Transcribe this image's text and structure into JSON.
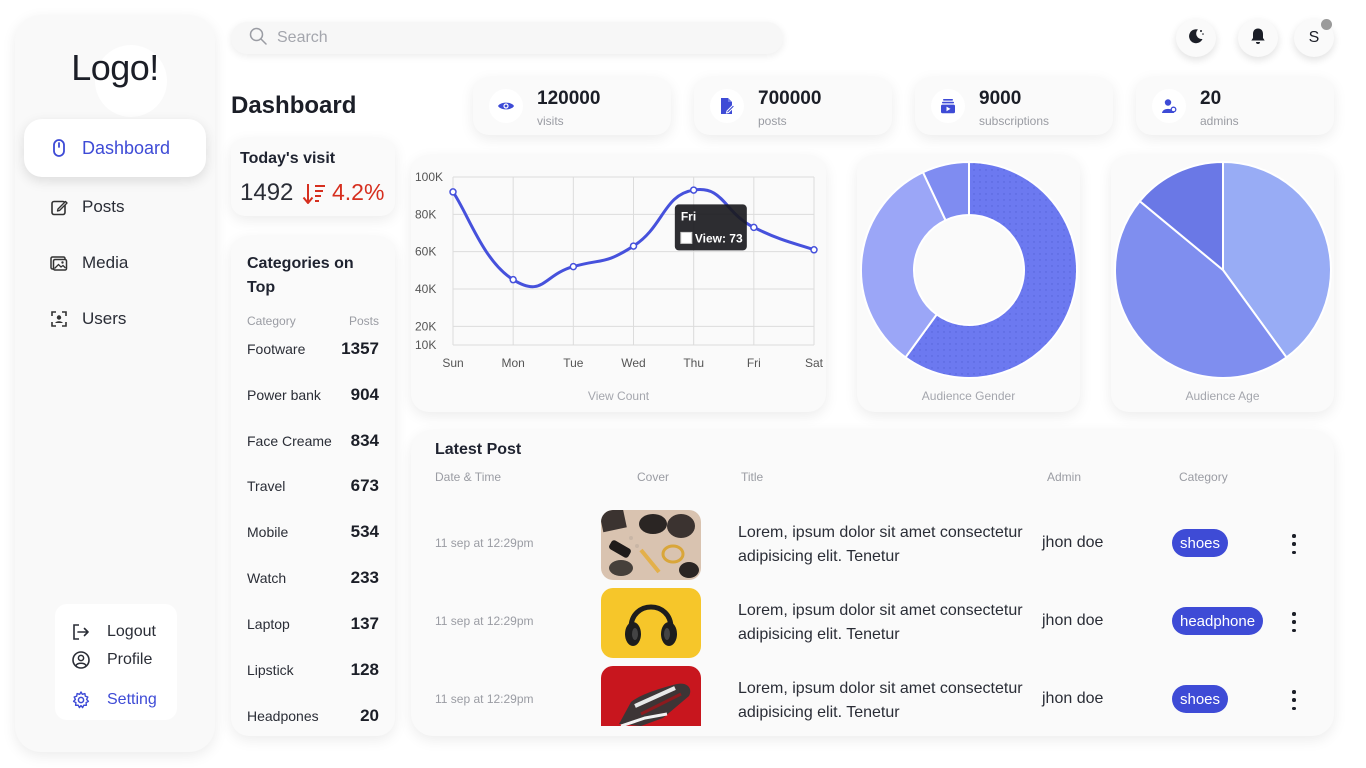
{
  "sidebar": {
    "logo": "Logo!",
    "nav": [
      {
        "label": "Dashboard",
        "icon": "dashboard-icon",
        "active": true
      },
      {
        "label": "Posts",
        "icon": "posts-icon"
      },
      {
        "label": "Media",
        "icon": "media-icon"
      },
      {
        "label": "Users",
        "icon": "users-icon"
      }
    ],
    "bottom": [
      {
        "label": "Logout",
        "icon": "logout-icon"
      },
      {
        "label": "Profile",
        "icon": "profile-icon"
      },
      {
        "label": "Setting",
        "icon": "gear-icon"
      }
    ]
  },
  "header": {
    "search_placeholder": "Search",
    "avatar_initial": "S"
  },
  "page_title": "Dashboard",
  "stats": [
    {
      "value": "120000",
      "label": "visits",
      "icon": "eye-icon"
    },
    {
      "value": "700000",
      "label": "posts",
      "icon": "edit-document-icon"
    },
    {
      "value": "9000",
      "label": "subscriptions",
      "icon": "subscriptions-icon"
    },
    {
      "value": "20",
      "label": "admins",
      "icon": "admin-user-icon"
    }
  ],
  "today": {
    "title": "Today's visit",
    "value": "1492",
    "change": "4.2%",
    "trend": "down"
  },
  "categories": {
    "title": "Categories on Top",
    "col_category": "Category",
    "col_posts": "Posts",
    "rows": [
      {
        "name": "Footware",
        "posts": "1357"
      },
      {
        "name": "Power bank",
        "posts": "904"
      },
      {
        "name": "Face Creame",
        "posts": "834"
      },
      {
        "name": "Travel",
        "posts": "673"
      },
      {
        "name": "Mobile",
        "posts": "534"
      },
      {
        "name": "Watch",
        "posts": "233"
      },
      {
        "name": "Laptop",
        "posts": "137"
      },
      {
        "name": "Lipstick",
        "posts": "128"
      },
      {
        "name": "Headpones",
        "posts": "20"
      }
    ]
  },
  "chart_data": [
    {
      "type": "line",
      "caption": "View Count",
      "x": [
        "Sun",
        "Mon",
        "Tue",
        "Wed",
        "Thu",
        "Fri",
        "Sat"
      ],
      "y_ticks": [
        "100K",
        "80K",
        "60K",
        "40K",
        "20K",
        "10K"
      ],
      "ylim": [
        10000,
        100000
      ],
      "series": [
        {
          "values": [
            92000,
            45000,
            52000,
            63000,
            93000,
            73000,
            61000
          ]
        }
      ],
      "tooltip": {
        "title": "Fri",
        "text": "View: 73"
      },
      "color": "#4651dc",
      "grid": true
    },
    {
      "type": "pie",
      "donut": true,
      "caption": "Audience Gender",
      "values": [
        60,
        33,
        7
      ],
      "colors": [
        "#6c79f0",
        "#9ba6f7",
        "#7f8cf1"
      ]
    },
    {
      "type": "pie",
      "caption": "Audience Age",
      "values": [
        40,
        46,
        14
      ],
      "colors": [
        "#98acf5",
        "#7f8eef",
        "#6a78e6"
      ]
    }
  ],
  "latest_post": {
    "title": "Latest Post",
    "headers": {
      "date": "Date & Time",
      "cover": "Cover",
      "title": "Title",
      "admin": "Admin",
      "category": "Category"
    },
    "rows": [
      {
        "date": "11 sep at 12:29pm",
        "cover": "accessories-photo",
        "title": "Lorem, ipsum dolor sit amet consectetur adipisicing elit. Tenetur",
        "admin": "jhon doe",
        "category": "shoes"
      },
      {
        "date": "11 sep at 12:29pm",
        "cover": "headphone-photo",
        "title": "Lorem, ipsum dolor sit amet consectetur adipisicing elit. Tenetur",
        "admin": "jhon doe",
        "category": "headphone"
      },
      {
        "date": "11 sep at 12:29pm",
        "cover": "sneaker-photo",
        "title": "Lorem, ipsum dolor sit amet consectetur adipisicing elit. Tenetur",
        "admin": "jhon doe",
        "category": "shoes"
      }
    ]
  },
  "colors": {
    "accent": "#3e4bd6",
    "down": "#d62f1f"
  }
}
